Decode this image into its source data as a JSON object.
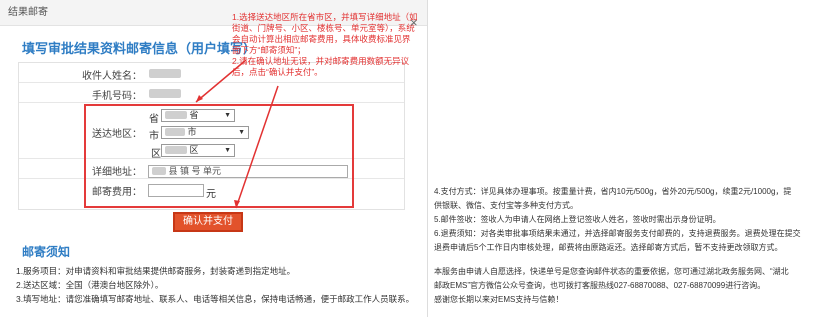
{
  "dialog": {
    "title": "结果邮寄",
    "close": "×"
  },
  "form": {
    "heading": "填写审批结果资料邮寄信息（用户填写）",
    "name_label": "收件人姓名：",
    "phone_label": "手机号码：",
    "region_label": "送达地区：",
    "province_prefix": "省",
    "province_value": "省",
    "city_prefix": "市",
    "city_value": "市",
    "district_prefix": "区",
    "district_value": "区",
    "address_label": "详细地址：",
    "address_value": "县 镇 号 单元",
    "fee_label": "邮寄费用：",
    "fee_unit": "元",
    "confirm_button": "确认并支付"
  },
  "annotation": {
    "line1": "1.选择送达地区所在省市区，并填写详细地址（如街道、门牌号、小区、楼栋号、单元室等），系统会自动计算出相应邮寄费用，具体收费标准见界面下方“邮寄须知”；",
    "line2": "2.请在确认地址无误，并对邮寄费用数额无异议后，点击“确认并支付”。"
  },
  "notice": {
    "title": "邮寄须知",
    "items": [
      "1.服务项目：对申请资料和审批结果提供邮寄服务，封装寄递到指定地址。",
      "2.送达区域：全国（港澳台地区除外）。",
      "3.填写地址：请您准确填写邮寄地址、联系人、电话等相关信息，保持电话畅通，便于邮政工作人员联系。"
    ]
  },
  "right_panel": {
    "lines": [
      "4.支付方式：详见具体办理事项。按重量计费，省内10元/500g，省外20元/500g，续重2元/1000g，提",
      "供银联、微信、支付宝等多种支付方式。",
      "5.邮件签收：签收人为申请人在网络上登记签收人姓名，签收时需出示身份证明。",
      "6.退费须知：对各类审批事项结果未通过，并选择邮寄服务支付邮费的，支持退费服务。退费处理在提交",
      "退费申请后5个工作日内审核处理，邮费将由原路返还。选择邮寄方式后，暂不支持更改领取方式。",
      "本服务由申请人自愿选择，快递单号是您查询邮件状态的重要依据，您可通过湖北政务服务网、“湖北",
      "邮政EMS”官方微信公众号查询，也可拨打客服热线027-68870088、027-68870099进行咨询。",
      "感谢您长期以来对EMS支持与信赖！"
    ]
  },
  "colors": {
    "accent_blue": "#2f7dc4",
    "annotation_red": "#e23232",
    "button_orange": "#e2522b"
  }
}
